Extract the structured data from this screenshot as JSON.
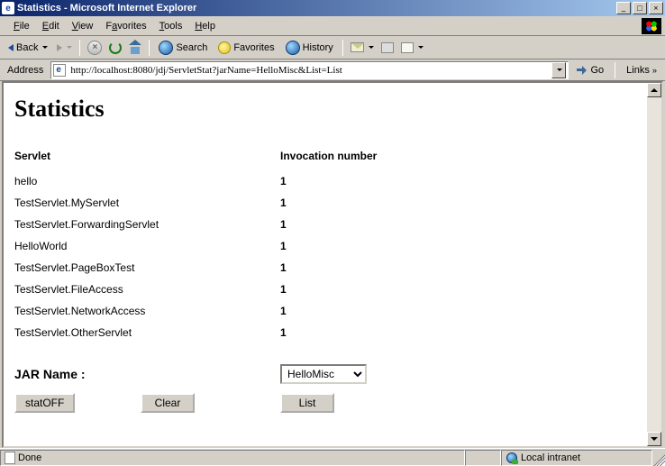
{
  "window": {
    "title": "Statistics - Microsoft Internet Explorer"
  },
  "menu": {
    "file": "File",
    "edit": "Edit",
    "view": "View",
    "favorites": "Favorites",
    "tools": "Tools",
    "help": "Help"
  },
  "toolbar": {
    "back": "Back",
    "search": "Search",
    "favorites": "Favorites",
    "history": "History"
  },
  "address": {
    "label": "Address",
    "url": "http://localhost:8080/jdj/ServletStat?jarName=HelloMisc&List=List",
    "go": "Go",
    "links": "Links"
  },
  "page": {
    "heading": "Statistics",
    "col_servlet": "Servlet",
    "col_invocation": "Invocation number",
    "rows": [
      {
        "name": "hello",
        "count": "1"
      },
      {
        "name": "TestServlet.MyServlet",
        "count": "1"
      },
      {
        "name": "TestServlet.ForwardingServlet",
        "count": "1"
      },
      {
        "name": "HelloWorld",
        "count": "1"
      },
      {
        "name": "TestServlet.PageBoxTest",
        "count": "1"
      },
      {
        "name": "TestServlet.FileAccess",
        "count": "1"
      },
      {
        "name": "TestServlet.NetworkAccess",
        "count": "1"
      },
      {
        "name": "TestServlet.OtherServlet",
        "count": "1"
      }
    ],
    "jar_label": "JAR Name :",
    "jar_value": "HelloMisc",
    "btn_statoff": "statOFF",
    "btn_clear": "Clear",
    "btn_list": "List"
  },
  "status": {
    "done": "Done",
    "zone": "Local intranet"
  }
}
